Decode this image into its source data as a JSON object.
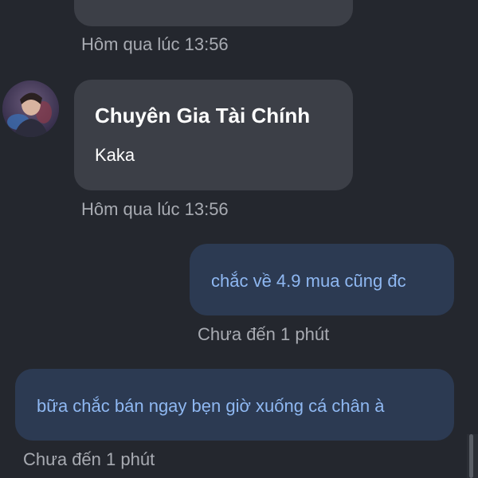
{
  "messages": [
    {
      "direction": "incoming",
      "sender": "",
      "text": "",
      "timestamp": "Hôm qua lúc 13:56"
    },
    {
      "direction": "incoming",
      "sender": "Chuyên Gia Tài Chính",
      "text": "Kaka",
      "timestamp": "Hôm qua lúc 13:56"
    },
    {
      "direction": "outgoing",
      "text": "chắc về 4.9 mua cũng đc",
      "timestamp": "Chưa đến 1 phút"
    },
    {
      "direction": "outgoing",
      "text": "bữa chắc bán ngay bẹn giờ xuống cá chân à",
      "timestamp": "Chưa đến 1 phút"
    }
  ],
  "colors": {
    "background": "#24272e",
    "incoming_bubble": "#3c3f47",
    "outgoing_bubble": "#2c3a52",
    "outgoing_text": "#8fb8f2",
    "timestamp_text": "#a8abb2"
  },
  "icons": {
    "avatar": "user-avatar-photo"
  }
}
